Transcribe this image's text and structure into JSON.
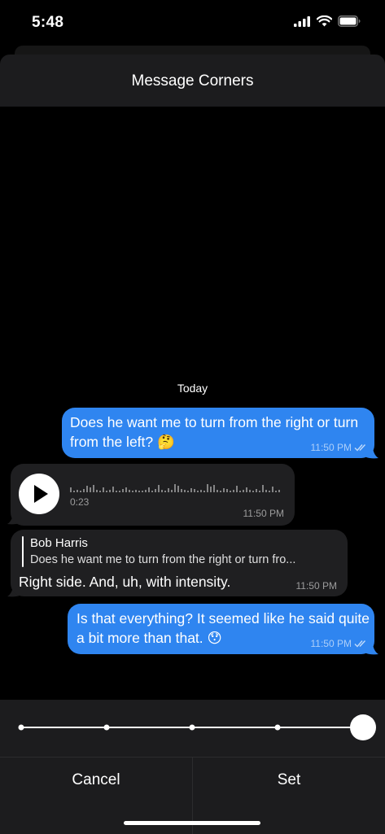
{
  "status": {
    "time": "5:48"
  },
  "sheet": {
    "title": "Message Corners"
  },
  "chat": {
    "date_label": "Today",
    "messages": [
      {
        "text": "Does he want me to turn from the right or turn from the left? 🤔",
        "time": "11:50 PM"
      },
      {
        "voice_duration": "0:23",
        "time": "11:50 PM"
      },
      {
        "reply_name": "Bob Harris",
        "reply_text": "Does he want me to turn from the right or turn fro...",
        "text": "Right side. And, uh, with intensity.",
        "time": "11:50 PM"
      },
      {
        "text": "Is that everything? It seemed like he said quite a bit more than that. 😯",
        "time": "11:50 PM"
      }
    ]
  },
  "slider": {
    "stops": 5,
    "selected_index": 4
  },
  "actions": {
    "cancel": "Cancel",
    "set": "Set"
  },
  "icons": {
    "signal": "signal-bars-icon",
    "wifi": "wifi-icon",
    "battery": "battery-icon",
    "read": "double-check-icon",
    "play": "play-icon"
  }
}
